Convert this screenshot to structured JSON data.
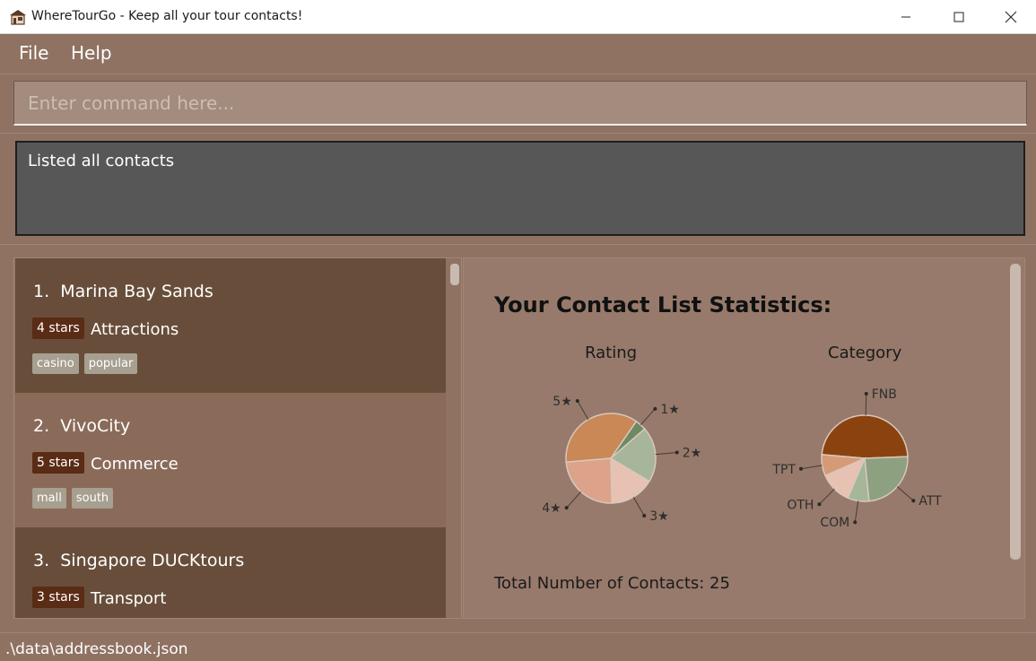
{
  "window": {
    "title": "WhereTourGo - Keep all your tour contacts!",
    "icon": "house-icon"
  },
  "menu": {
    "file": "File",
    "help": "Help"
  },
  "command": {
    "placeholder": "Enter command here...",
    "value": ""
  },
  "result": {
    "text": "Listed all contacts"
  },
  "contacts": [
    {
      "index": "1.",
      "name": "Marina Bay Sands",
      "rating": "4 stars",
      "category": "Attractions",
      "tags": [
        "casino",
        "popular"
      ]
    },
    {
      "index": "2.",
      "name": "VivoCity",
      "rating": "5 stars",
      "category": "Commerce",
      "tags": [
        "mall",
        "south"
      ]
    },
    {
      "index": "3.",
      "name": "Singapore DUCKtours",
      "rating": "3 stars",
      "category": "Transport",
      "tags": []
    }
  ],
  "stats": {
    "title": "Your Contact List Statistics:",
    "total_label": "Total Number of Contacts: 25"
  },
  "chart_data": [
    {
      "type": "pie",
      "title": "Rating",
      "slices": [
        {
          "label": "5★",
          "value": 9,
          "color": "#c98856"
        },
        {
          "label": "1★",
          "value": 1,
          "color": "#6e8a62"
        },
        {
          "label": "2★",
          "value": 5,
          "color": "#a7b59b"
        },
        {
          "label": "3★",
          "value": 4,
          "color": "#e7c2b2"
        },
        {
          "label": "4★",
          "value": 6,
          "color": "#dca38a"
        }
      ]
    },
    {
      "type": "pie",
      "title": "Category",
      "slices": [
        {
          "label": "FNB",
          "value": 12,
          "color": "#8a430f"
        },
        {
          "label": "ATT",
          "value": 6,
          "color": "#8da07f"
        },
        {
          "label": "COM",
          "value": 2,
          "color": "#a6b698"
        },
        {
          "label": "OTH",
          "value": 3,
          "color": "#e7c2b2"
        },
        {
          "label": "TPT",
          "value": 2,
          "color": "#d79a77"
        }
      ]
    }
  ],
  "status": {
    "path": ".\\data\\addressbook.json"
  }
}
